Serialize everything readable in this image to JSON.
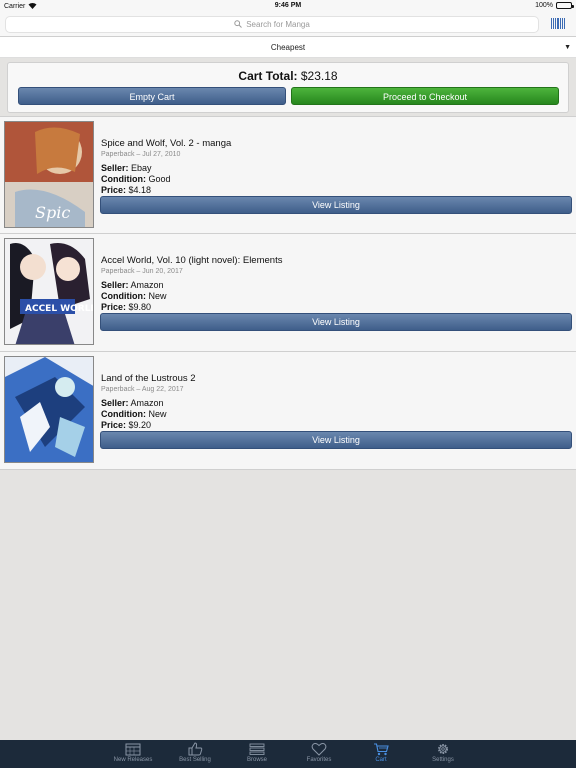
{
  "status_bar": {
    "carrier": "Carrier",
    "time": "9:46 PM",
    "battery": "100%",
    "battery_level": 1.0
  },
  "search": {
    "placeholder": "Search for Manga"
  },
  "sort": {
    "selected": "Cheapest"
  },
  "cart": {
    "total_label": "Cart Total:",
    "total_value": "$23.18",
    "empty_label": "Empty Cart",
    "checkout_label": "Proceed to Checkout"
  },
  "listings": [
    {
      "title": "Spice and Wolf, Vol. 2 - manga",
      "meta": "Paperback – Jul 27, 2010",
      "seller_label": "Seller:",
      "seller": "Ebay",
      "condition_label": "Condition:",
      "condition": "Good",
      "price_label": "Price:",
      "price": "$4.18",
      "button": "View Listing"
    },
    {
      "title": "Accel World, Vol. 10 (light novel): Elements",
      "meta": "Paperback – Jun 20, 2017",
      "seller_label": "Seller:",
      "seller": "Amazon",
      "condition_label": "Condition:",
      "condition": "New",
      "price_label": "Price:",
      "price": "$9.80",
      "button": "View Listing"
    },
    {
      "title": "Land of the Lustrous 2",
      "meta": "Paperback – Aug 22, 2017",
      "seller_label": "Seller:",
      "seller": "Amazon",
      "condition_label": "Condition:",
      "condition": "New",
      "price_label": "Price:",
      "price": "$9.20",
      "button": "View Listing"
    }
  ],
  "tabs": [
    {
      "label": "New Releases",
      "icon": "calendar-icon"
    },
    {
      "label": "Best Selling",
      "icon": "thumbs-up-icon"
    },
    {
      "label": "Browse",
      "icon": "list-icon"
    },
    {
      "label": "Favorites",
      "icon": "heart-icon"
    },
    {
      "label": "Cart",
      "icon": "cart-icon",
      "active": true
    },
    {
      "label": "Settings",
      "icon": "gear-icon"
    }
  ],
  "colors": {
    "primary_button": "#4a6891",
    "checkout_button": "#2f9a25",
    "tab_bar": "#1c2a3a",
    "tab_active": "#4a90e2"
  }
}
